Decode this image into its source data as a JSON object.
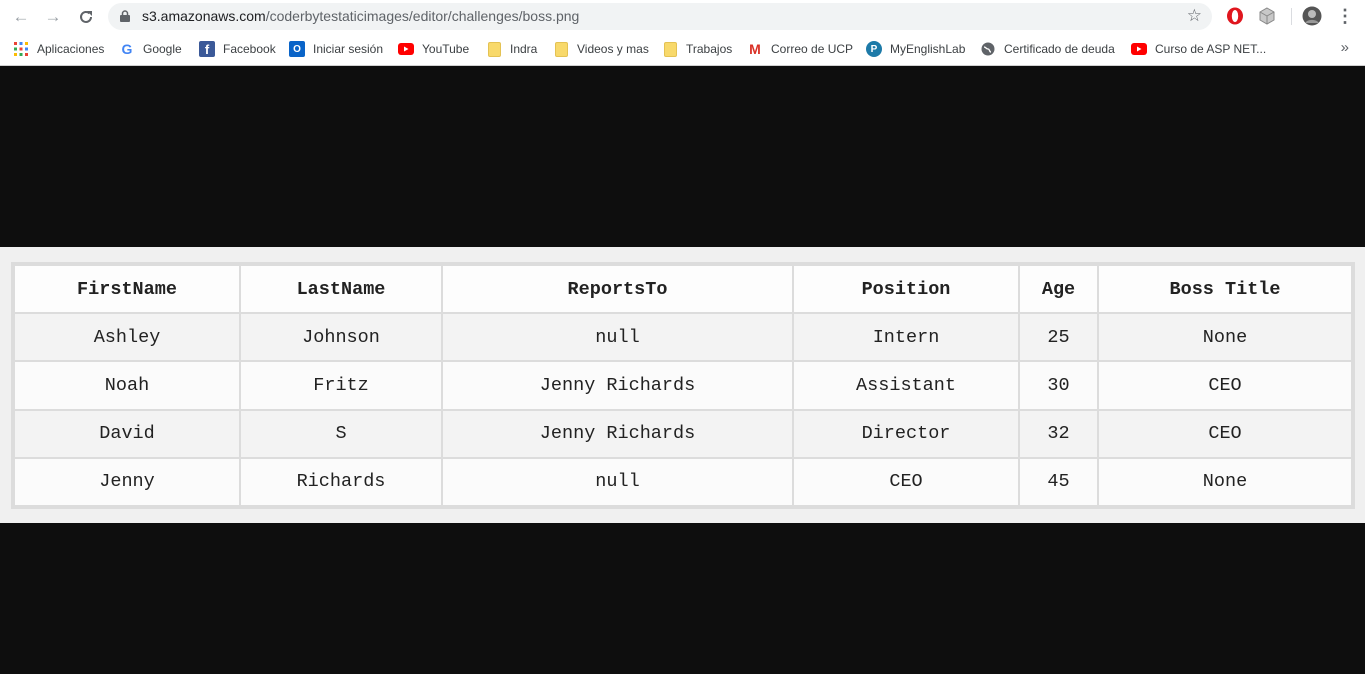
{
  "browser": {
    "url_host": "s3.amazonaws.com",
    "url_path": "/coderbytestaticimages/editor/challenges/boss.png",
    "bookmarks": [
      {
        "label": "Aplicaciones",
        "icon": "apps-grid-icon"
      },
      {
        "label": "Google",
        "icon": "google-icon"
      },
      {
        "label": "Facebook",
        "icon": "facebook-icon"
      },
      {
        "label": "Iniciar sesión",
        "icon": "outlook-icon"
      },
      {
        "label": "YouTube",
        "icon": "youtube-icon"
      },
      {
        "label": "Indra",
        "icon": "folder-icon"
      },
      {
        "label": "Videos y mas",
        "icon": "folder-icon"
      },
      {
        "label": "Trabajos",
        "icon": "folder-icon"
      },
      {
        "label": "Correo de UCP",
        "icon": "gmail-icon"
      },
      {
        "label": "MyEnglishLab",
        "icon": "pearson-icon"
      },
      {
        "label": "Certificado de deuda",
        "icon": "globe-icon"
      },
      {
        "label": "Curso de ASP NET...",
        "icon": "youtube-icon"
      }
    ],
    "more_label": "»"
  },
  "table": {
    "headers": [
      "FirstName",
      "LastName",
      "ReportsTo",
      "Position",
      "Age",
      "Boss Title"
    ],
    "rows": [
      [
        "Ashley",
        "Johnson",
        "null",
        "Intern",
        "25",
        "None"
      ],
      [
        "Noah",
        "Fritz",
        "Jenny Richards",
        "Assistant",
        "30",
        "CEO"
      ],
      [
        "David",
        "S",
        "Jenny Richards",
        "Director",
        "32",
        "CEO"
      ],
      [
        "Jenny",
        "Richards",
        "null",
        "CEO",
        "45",
        "None"
      ]
    ]
  },
  "colors": {
    "page_background": "#0e0e0e",
    "table_band": "#f0f0f0",
    "youtube_red": "#ff0000",
    "facebook_blue": "#3b5998"
  }
}
